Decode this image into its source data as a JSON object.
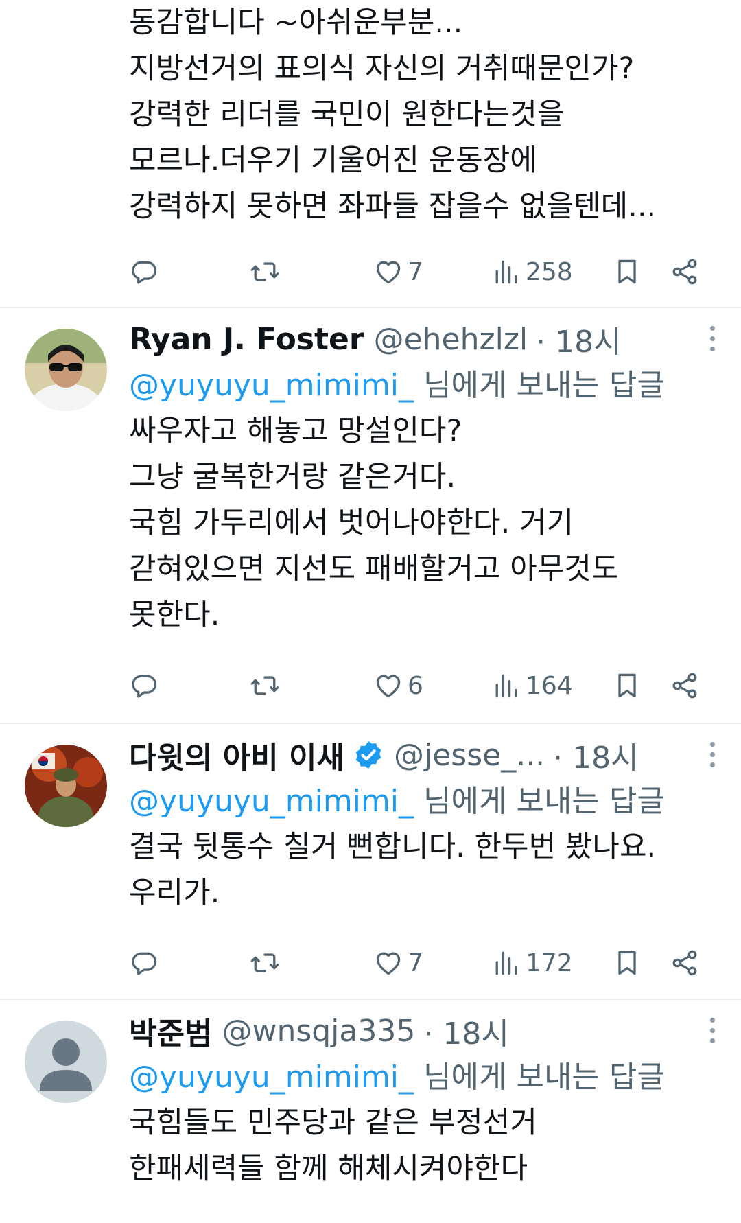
{
  "tweets": [
    {
      "lines": [
        "동감합니다 ~아쉬운부분...",
        "지방선거의 표의식 자신의 거취때문인가?",
        "강력한 리더를 국민이 원한다는것을",
        "모르나.더우기 기울어진 운동장에",
        "강력하지 못하면 좌파들 잡을수 없을텐데..."
      ],
      "likes": "7",
      "views": "258"
    },
    {
      "name": "Ryan J. Foster",
      "handle": "@ehehzlzl",
      "time": "· 18시",
      "reply_mention": "@yuyuyu_mimimi_",
      "reply_suffix": " 님에게 보내는 답글",
      "lines": [
        "싸우자고 해놓고 망설인다?",
        "그냥 굴복한거랑 같은거다.",
        "국힘 가두리에서 벗어나야한다. 거기",
        "갇혀있으면 지선도 패배할거고 아무것도",
        "못한다."
      ],
      "likes": "6",
      "views": "164"
    },
    {
      "name": "다윗의 아비 이새",
      "handle": "@jesse_...",
      "time": "· 18시",
      "reply_mention": "@yuyuyu_mimimi_",
      "reply_suffix": " 님에게 보내는 답글",
      "lines": [
        "결국 뒷통수 칠거 뻔합니다. 한두번 봤나요.",
        "우리가."
      ],
      "likes": "7",
      "views": "172"
    },
    {
      "name": "박준범",
      "handle": "@wnsqja335",
      "time": "· 18시",
      "reply_mention": "@yuyuyu_mimimi_",
      "reply_suffix": " 님에게 보내는 답글",
      "lines": [
        "국힘들도 민주당과 같은 부정선거",
        "한패세력들 함께 해체시켜야한다"
      ]
    }
  ],
  "colors": {
    "text": "#0f1419",
    "secondary": "#536471",
    "link": "#1d9bf0",
    "divider": "#e9edf0"
  },
  "icons": [
    "reply-icon",
    "retweet-icon",
    "like-icon",
    "views-icon",
    "bookmark-icon",
    "share-icon",
    "more-icon",
    "verified-icon"
  ]
}
